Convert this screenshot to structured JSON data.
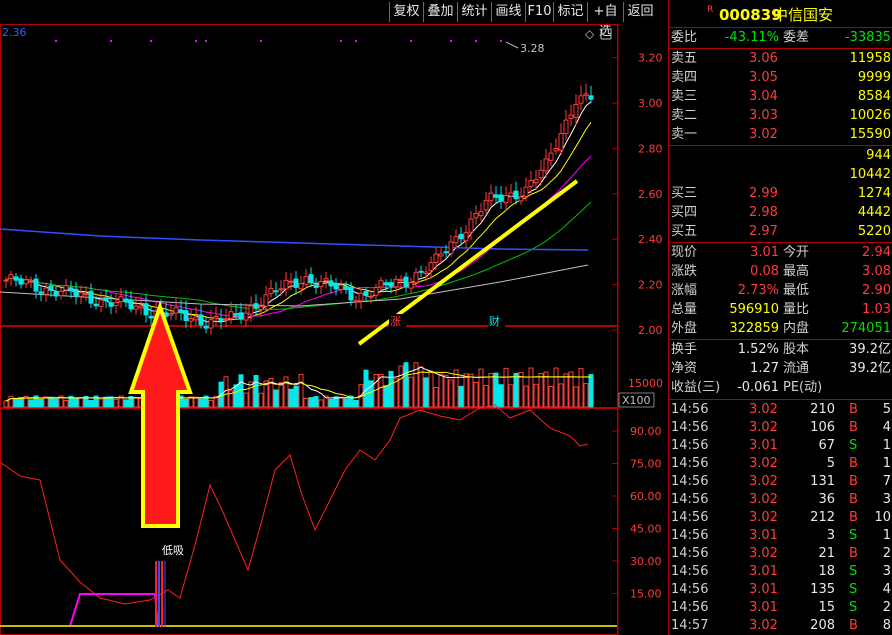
{
  "toolbar": {
    "buttons": [
      "复权",
      "叠加",
      "统计",
      "画线",
      "F10",
      "标记",
      "+自选",
      "返回"
    ]
  },
  "stock": {
    "badge": "R",
    "code": "000839",
    "name": "中信国安"
  },
  "main_chart": {
    "top_left_value": "2.36",
    "high_marker": "3.28",
    "price_ticks": [
      "3.20",
      "3.00",
      "2.80",
      "2.60",
      "2.40",
      "2.20",
      "2.00"
    ],
    "event_tags": [
      "涨",
      "财"
    ]
  },
  "volume_chart": {
    "tick": "15000",
    "unit": "X100"
  },
  "indicator_chart": {
    "ticks": [
      "90.00",
      "75.00",
      "60.00",
      "45.00",
      "30.00",
      "15.00"
    ],
    "signal_label": "低吸"
  },
  "order_book": {
    "webi_label": "委比",
    "webi_value": "-43.11%",
    "weicha_label": "委差",
    "weicha_value": "-33835",
    "asks": [
      {
        "label": "卖五",
        "price": "3.06",
        "volume": "11958"
      },
      {
        "label": "卖四",
        "price": "3.05",
        "volume": "9999"
      },
      {
        "label": "卖三",
        "price": "3.04",
        "volume": "8584"
      },
      {
        "label": "卖二",
        "price": "3.03",
        "volume": "10026"
      },
      {
        "label": "卖一",
        "price": "3.02",
        "volume": "15590"
      }
    ],
    "bids": [
      {
        "label": "",
        "price": "",
        "volume": "944"
      },
      {
        "label": "",
        "price": "",
        "volume": "10442"
      },
      {
        "label": "买三",
        "price": "2.99",
        "volume": "1274"
      },
      {
        "label": "买四",
        "price": "2.98",
        "volume": "4442"
      },
      {
        "label": "买五",
        "price": "2.97",
        "volume": "5220"
      }
    ]
  },
  "stats": [
    {
      "l1": "现价",
      "v1": "3.01",
      "l2": "今开",
      "v2": "2.94"
    },
    {
      "l1": "涨跌",
      "v1": "0.08",
      "l2": "最高",
      "v2": "3.08"
    },
    {
      "l1": "涨幅",
      "v1": "2.73%",
      "l2": "最低",
      "v2": "2.90"
    },
    {
      "l1": "总量",
      "v1": "596910",
      "l2": "量比",
      "v2": "1.03"
    },
    {
      "l1": "外盘",
      "v1": "322859",
      "l2": "内盘",
      "v2": "274051"
    }
  ],
  "fundamentals": [
    {
      "l1": "换手",
      "v1": "1.52%",
      "l2": "股本",
      "v2": "39.2亿"
    },
    {
      "l1": "净资",
      "v1": "1.27",
      "l2": "流通",
      "v2": "39.2亿"
    },
    {
      "l1": "收益(三)",
      "v1": "-0.061",
      "l2": "PE(动)",
      "v2": ""
    }
  ],
  "trades": [
    {
      "time": "14:56",
      "price": "3.02",
      "vol": "210",
      "side": "B",
      "n": "5"
    },
    {
      "time": "14:56",
      "price": "3.02",
      "vol": "106",
      "side": "B",
      "n": "4"
    },
    {
      "time": "14:56",
      "price": "3.01",
      "vol": "67",
      "side": "S",
      "n": "1"
    },
    {
      "time": "14:56",
      "price": "3.02",
      "vol": "5",
      "side": "B",
      "n": "1"
    },
    {
      "time": "14:56",
      "price": "3.02",
      "vol": "131",
      "side": "B",
      "n": "7"
    },
    {
      "time": "14:56",
      "price": "3.02",
      "vol": "36",
      "side": "B",
      "n": "3"
    },
    {
      "time": "14:56",
      "price": "3.02",
      "vol": "212",
      "side": "B",
      "n": "10"
    },
    {
      "time": "14:56",
      "price": "3.01",
      "vol": "3",
      "side": "S",
      "n": "1"
    },
    {
      "time": "14:56",
      "price": "3.02",
      "vol": "21",
      "side": "B",
      "n": "2"
    },
    {
      "time": "14:56",
      "price": "3.01",
      "vol": "18",
      "side": "S",
      "n": "3"
    },
    {
      "time": "14:56",
      "price": "3.01",
      "vol": "135",
      "side": "S",
      "n": "4"
    },
    {
      "time": "14:56",
      "price": "3.01",
      "vol": "15",
      "side": "S",
      "n": "2"
    },
    {
      "time": "14:57",
      "price": "3.02",
      "vol": "208",
      "side": "B",
      "n": "8"
    }
  ],
  "colors": {
    "up": "#ff3b3b",
    "down": "#00e8e8",
    "ma5": "#ffffff",
    "ma10": "#ffff00",
    "ma20": "#ff00ff",
    "ma60": "#00c000",
    "ma120": "#3050ff",
    "ma250": "#c0c0c0",
    "indicator": "#ff2020"
  }
}
